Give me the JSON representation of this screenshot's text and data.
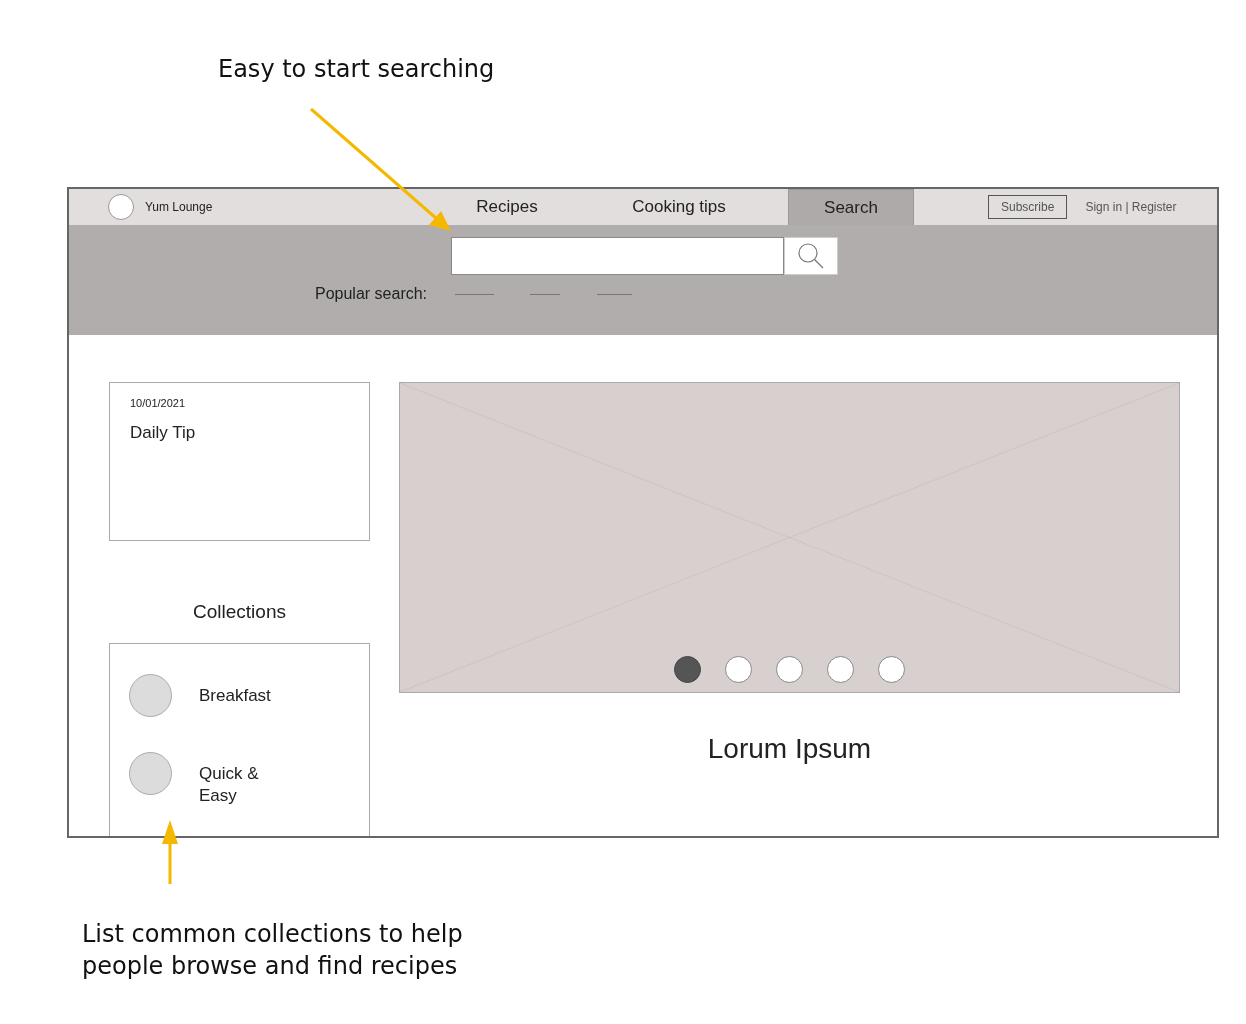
{
  "annotations": [
    {
      "text": "Easy to start searching"
    },
    {
      "text": "List common collections to help people browse and find recipes"
    }
  ],
  "nav": {
    "brand": "Yum Lounge",
    "tabs": [
      {
        "label": "Recipes",
        "selected": false
      },
      {
        "label": "Cooking tips",
        "selected": false
      },
      {
        "label": "Search",
        "selected": true
      }
    ],
    "subscribe": "Subscribe",
    "sign_in": "Sign in | Register"
  },
  "search": {
    "label": "Popular search:"
  },
  "daily_tip": {
    "date": "10/01/2021",
    "title": "Daily Tip"
  },
  "collections": {
    "heading": "Collections",
    "items": [
      {
        "label": "Breakfast"
      },
      {
        "label": "Quick & Easy"
      }
    ]
  },
  "carousel": {
    "dots": [
      {
        "selected": true
      },
      {
        "selected": false
      },
      {
        "selected": false
      },
      {
        "selected": false
      },
      {
        "selected": false
      }
    ],
    "caption": "Lorum Ipsum"
  }
}
